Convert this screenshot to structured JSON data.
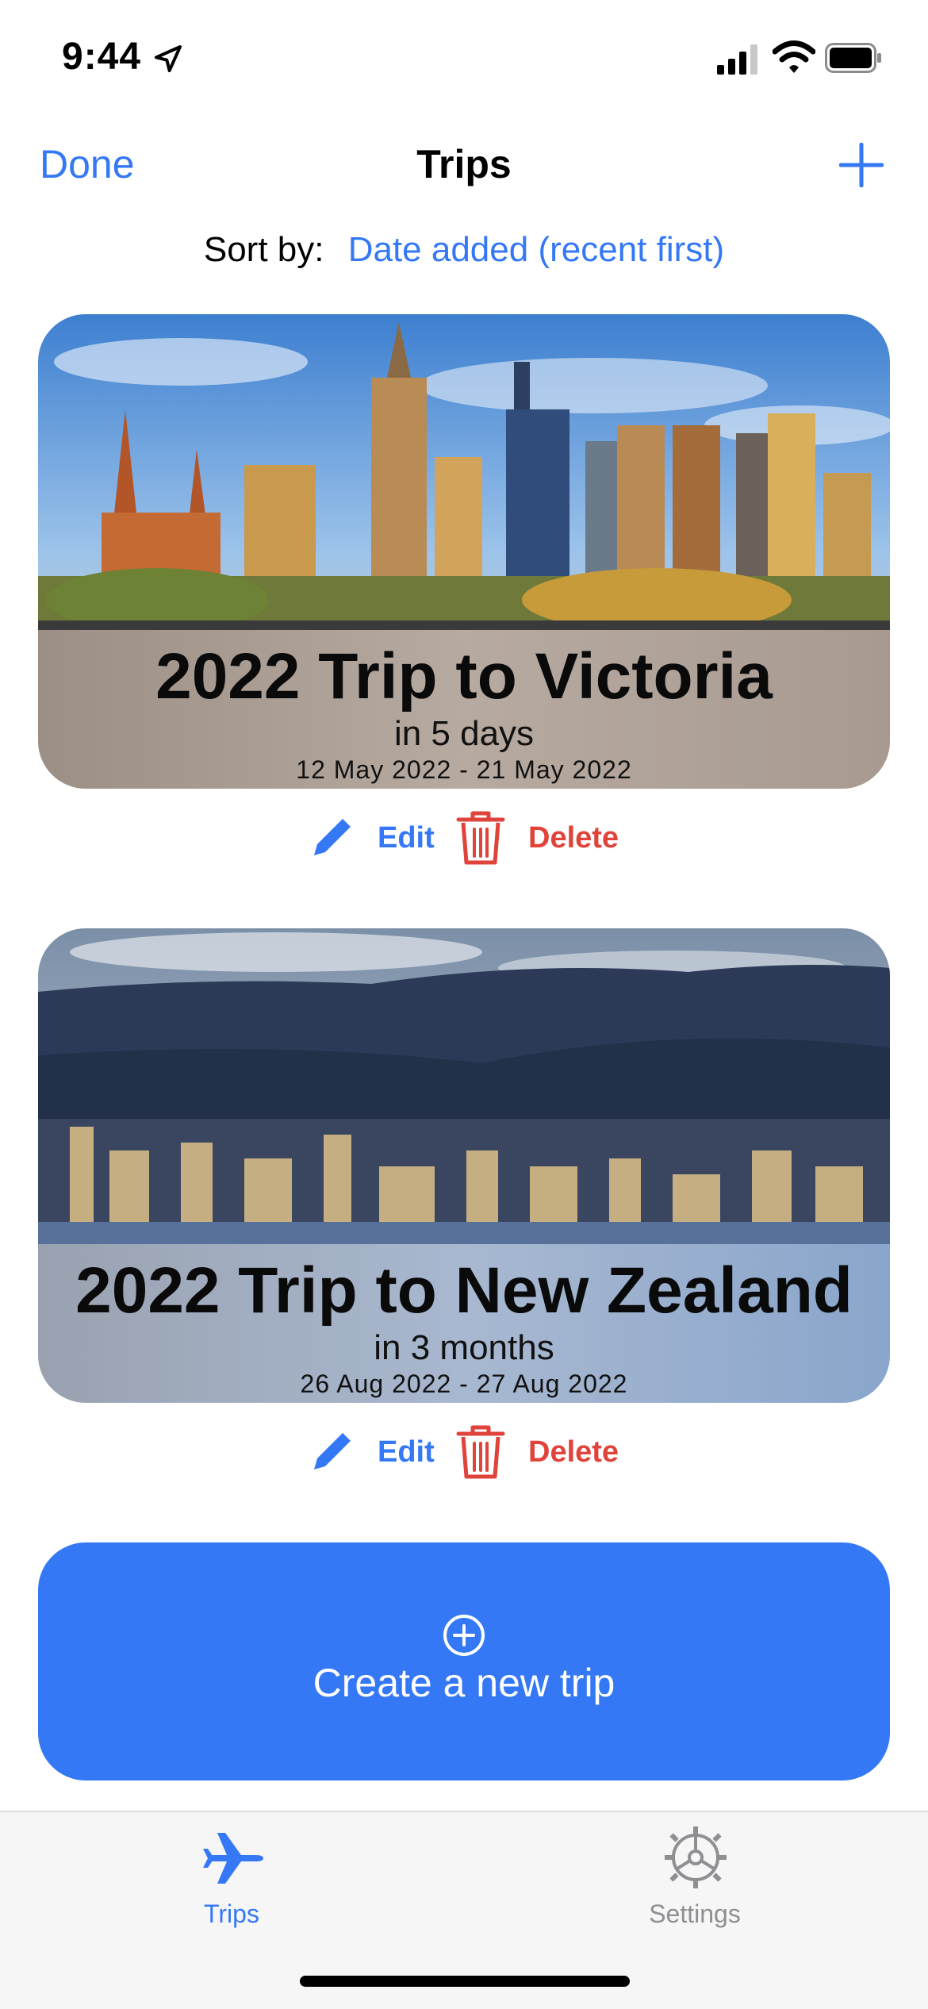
{
  "status_bar": {
    "time": "9:44"
  },
  "nav": {
    "done_label": "Done",
    "title": "Trips"
  },
  "sort": {
    "label": "Sort by:",
    "value": "Date added (recent first)"
  },
  "trips": [
    {
      "title": "2022 Trip to Victoria",
      "countdown": "in 5 days",
      "dates": "12 May 2022 - 21 May 2022",
      "edit_label": "Edit",
      "delete_label": "Delete"
    },
    {
      "title": "2022 Trip to New Zealand",
      "countdown": "in 3 months",
      "dates": "26 Aug 2022 - 27 Aug 2022",
      "edit_label": "Edit",
      "delete_label": "Delete"
    }
  ],
  "create_button": {
    "label": "Create a new trip"
  },
  "tab_bar": {
    "items": [
      {
        "label": "Trips",
        "icon": "airplane-icon",
        "selected": true
      },
      {
        "label": "Settings",
        "icon": "gear-icon",
        "selected": false
      }
    ]
  },
  "colors": {
    "accent": "#3478F6",
    "destructive": "#E0433A",
    "tab_inactive": "#8e8e93"
  }
}
